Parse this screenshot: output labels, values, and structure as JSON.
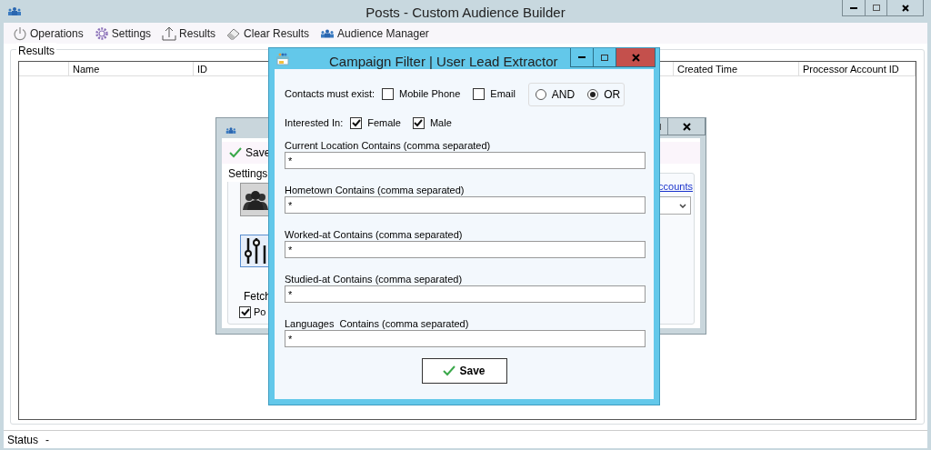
{
  "main_window": {
    "title": "Posts - Custom Audience Builder",
    "toolbar": [
      {
        "label": "Operations",
        "kind": "power"
      },
      {
        "label": "Settings",
        "kind": "gear"
      },
      {
        "label": "Results",
        "kind": "upload"
      },
      {
        "label": "Clear Results",
        "kind": "eraser"
      },
      {
        "label": "Audience Manager",
        "kind": "people"
      }
    ],
    "results_group": {
      "title": "Results",
      "columns": [
        "Name",
        "ID",
        "Created Time",
        "Processor Account ID"
      ]
    },
    "status_bar": {
      "label": "Status",
      "value": "-"
    }
  },
  "settings_window": {
    "save_button": "Save",
    "group_title": "Settings",
    "link": "ccounts",
    "fetch_label": "Fetch",
    "checkbox": {
      "label": "Po",
      "checked": true
    }
  },
  "dialog": {
    "title": "Campaign Filter | User Lead Extractor",
    "contacts": {
      "label": "Contacts must exist:",
      "options": [
        {
          "label": "Mobile Phone",
          "checked": false
        },
        {
          "label": "Email",
          "checked": false
        }
      ],
      "logic": [
        {
          "label": "AND",
          "selected": false
        },
        {
          "label": "OR",
          "selected": true
        }
      ]
    },
    "interested": {
      "label": "Interested In:",
      "options": [
        {
          "label": "Female",
          "checked": true
        },
        {
          "label": "Male",
          "checked": true
        }
      ]
    },
    "fields": [
      {
        "label": "Current Location Contains (comma separated)",
        "value": "*"
      },
      {
        "label": "Hometown Contains (comma separated)",
        "value": "*"
      },
      {
        "label": "Worked-at Contains (comma separated)",
        "value": "*"
      },
      {
        "label": "Studied-at Contains (comma separated)",
        "value": "*"
      },
      {
        "label": "Languages  Contains (comma separated)",
        "value": "*"
      }
    ],
    "save_button": "Save"
  }
}
